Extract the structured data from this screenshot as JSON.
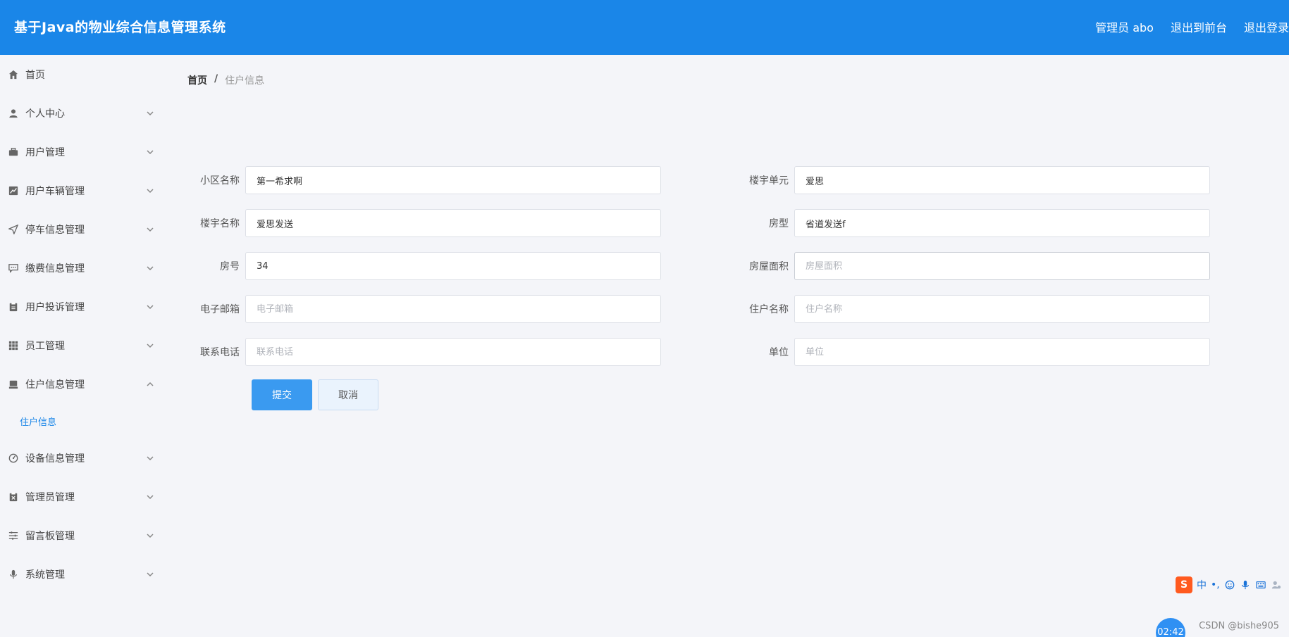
{
  "app": {
    "title": "基于Java的物业综合信息管理系统",
    "user_label": "管理员 abo",
    "goto_front": "退出到前台",
    "logout": "退出登录"
  },
  "sidebar": {
    "items": [
      {
        "label": "首页",
        "icon": "home-icon"
      },
      {
        "label": "个人中心",
        "icon": "user-icon"
      },
      {
        "label": "用户管理",
        "icon": "briefcase-icon"
      },
      {
        "label": "用户车辆管理",
        "icon": "chart-icon"
      },
      {
        "label": "停车信息管理",
        "icon": "send-icon"
      },
      {
        "label": "缴费信息管理",
        "icon": "message-icon"
      },
      {
        "label": "用户投诉管理",
        "icon": "clipboard-icon"
      },
      {
        "label": "员工管理",
        "icon": "grid-icon"
      },
      {
        "label": "住户信息管理",
        "icon": "stamp-icon"
      },
      {
        "label": "设备信息管理",
        "icon": "gauge-icon"
      },
      {
        "label": "管理员管理",
        "icon": "close-square-icon"
      },
      {
        "label": "留言板管理",
        "icon": "sliders-icon"
      },
      {
        "label": "系统管理",
        "icon": "mic-icon"
      }
    ],
    "submenu": {
      "label": "住户信息"
    }
  },
  "breadcrumb": {
    "home": "首页",
    "separator": "/",
    "current": "住户信息"
  },
  "form": {
    "community_name": {
      "label": "小区名称",
      "value": "第一希求啊",
      "placeholder": "小区名称"
    },
    "building_unit": {
      "label": "楼宇单元",
      "value": "爱思",
      "placeholder": "楼宇单元"
    },
    "building_name": {
      "label": "楼宇名称",
      "value": "爱思发送",
      "placeholder": "楼宇名称"
    },
    "room_type": {
      "label": "房型",
      "value": "省道发送f",
      "placeholder": "房型"
    },
    "room_number": {
      "label": "房号",
      "value": "34",
      "placeholder": "房号"
    },
    "room_area": {
      "label": "房屋面积",
      "value": "",
      "placeholder": "房屋面积"
    },
    "email": {
      "label": "电子邮箱",
      "value": "",
      "placeholder": "电子邮箱"
    },
    "resident_name": {
      "label": "住户名称",
      "value": "",
      "placeholder": "住户名称"
    },
    "phone": {
      "label": "联系电话",
      "value": "",
      "placeholder": "联系电话"
    },
    "unit": {
      "label": "单位",
      "value": "",
      "placeholder": "单位"
    },
    "submit_label": "提交",
    "cancel_label": "取消"
  },
  "ime": {
    "logo": "S",
    "mode": "中",
    "punct": "•,"
  },
  "clock": "02:42",
  "watermark": "CSDN @bishe905",
  "colors": {
    "header": "#1a86e8",
    "primary_button": "#3a9af0",
    "active_submenu": "#1a86e8"
  }
}
